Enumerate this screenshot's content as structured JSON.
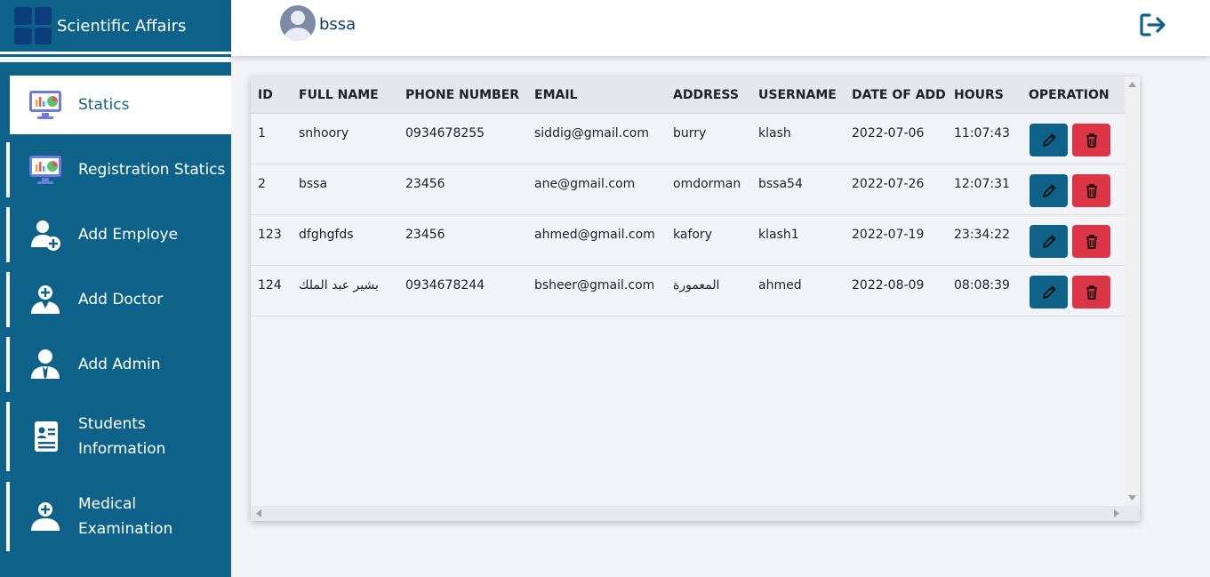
{
  "app": {
    "title": "Scientific Affairs"
  },
  "user": {
    "name": "bssa"
  },
  "sidebar": {
    "items": [
      {
        "label": "Statics",
        "icon": "monitor-chart-icon",
        "active": true
      },
      {
        "label": "Registration Statics",
        "icon": "monitor-chart-icon",
        "active": false
      },
      {
        "label": "Add Employe",
        "icon": "user-add-icon",
        "active": false
      },
      {
        "label": "Add Doctor",
        "icon": "doctor-icon",
        "active": false
      },
      {
        "label": "Add Admin",
        "icon": "admin-icon",
        "active": false
      },
      {
        "label": "Students Information",
        "icon": "id-card-icon",
        "active": false
      },
      {
        "label": "Medical Examination",
        "icon": "medical-icon",
        "active": false
      }
    ]
  },
  "table": {
    "columns": [
      "ID",
      "FULL NAME",
      "PHONE NUMBER",
      "EMAIL",
      "ADDRESS",
      "USERNAME",
      "DATE OF ADD",
      "HOURS",
      "OPERATION"
    ],
    "rows": [
      {
        "id": "1",
        "full_name": "snhoory",
        "phone": "0934678255",
        "email": "siddig@gmail.com",
        "address": "burry",
        "username": "klash",
        "date": "2022-07-06",
        "hours": "11:07:43"
      },
      {
        "id": "2",
        "full_name": "bssa",
        "phone": "23456",
        "email": "ane@gmail.com",
        "address": "omdorman",
        "username": "bssa54",
        "date": "2022-07-26",
        "hours": "12:07:31"
      },
      {
        "id": "123",
        "full_name": "dfghgfds",
        "phone": "23456",
        "email": "ahmed@gmail.com",
        "address": "kafory",
        "username": "klash1",
        "date": "2022-07-19",
        "hours": "23:34:22"
      },
      {
        "id": "124",
        "full_name": "بشير عبد الملك",
        "phone": "0934678244",
        "email": "bsheer@gmail.com",
        "address": "المعمورة",
        "username": "ahmed",
        "date": "2022-08-09",
        "hours": "08:08:39"
      }
    ]
  },
  "colors": {
    "primary": "#0e6289",
    "danger": "#dc3545",
    "brand_dark": "#0b3d7a"
  }
}
